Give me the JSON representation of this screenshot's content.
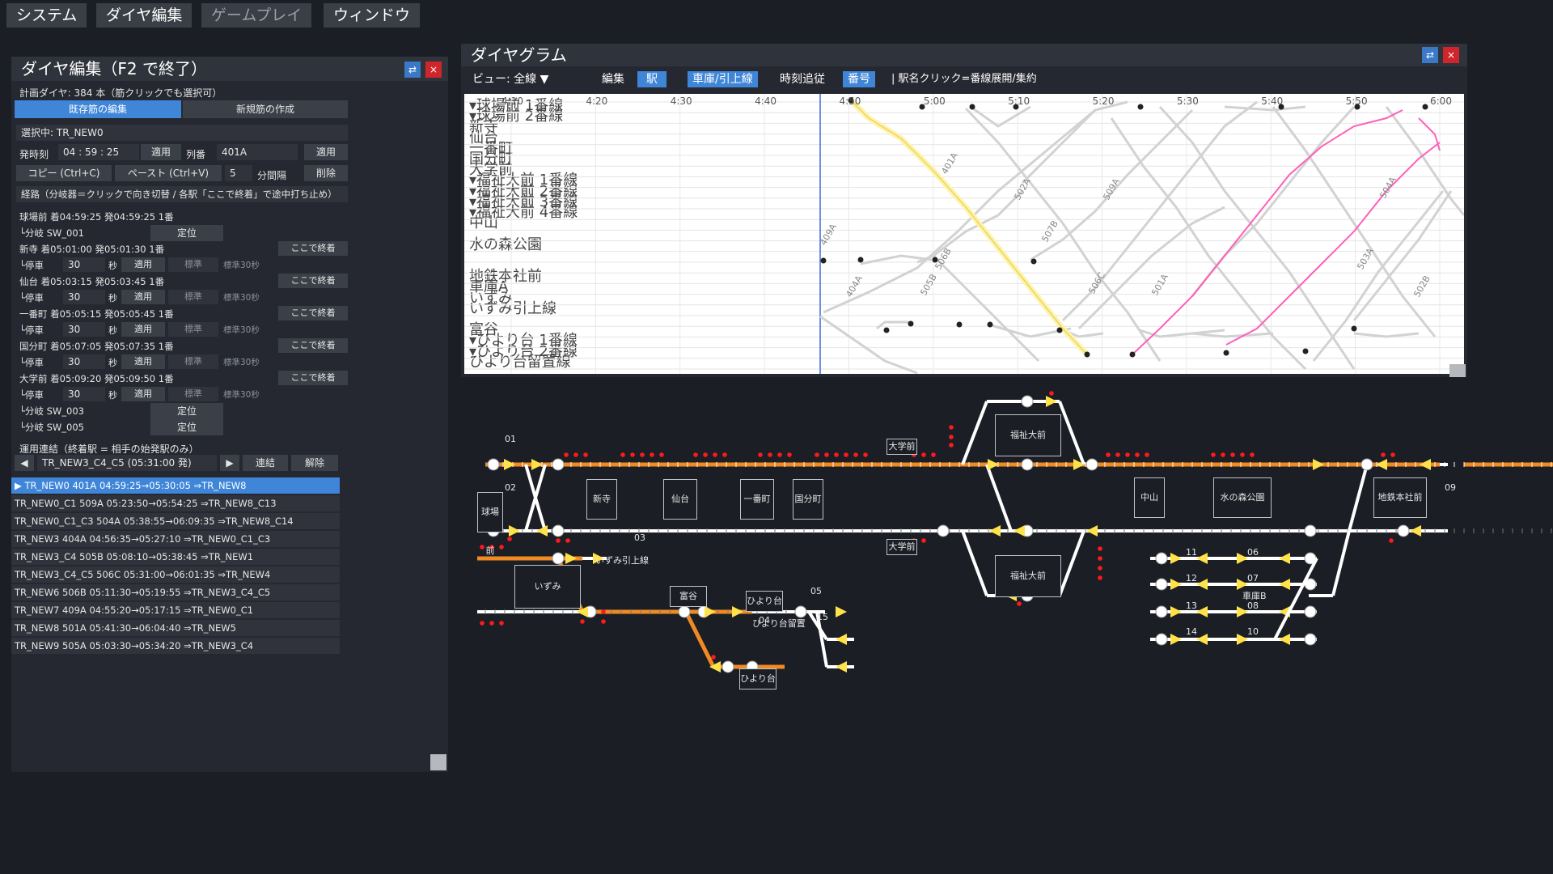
{
  "menu": [
    "システム",
    "ダイヤ編集",
    "ゲームプレイ",
    "ウィンドウ"
  ],
  "editor": {
    "title": "ダイヤ編集（F2 で終了）",
    "btn_restore": "⇄",
    "btn_close": "×",
    "plan_count": "計画ダイヤ: 384 本（筋クリックでも選択可）",
    "tab_existing": "既存筋の編集",
    "tab_new": "新規筋の作成",
    "selected": "選択中: TR_NEW0",
    "depart_label": "発時刻",
    "depart_h": "04",
    "depart_m": "59",
    "depart_s": "25",
    "apply": "適用",
    "trainno_label": "列番",
    "trainno": "401A",
    "copy": "コピー (Ctrl+C)",
    "paste": "ペースト (Ctrl+V)",
    "interval_value": "5",
    "interval_label": "分間隔",
    "delete": "削除",
    "route_header": "経路（分岐器＝クリックで向き切替 / 各駅「ここで終着」で途中打ち止め）",
    "route": [
      {
        "label": "球場前 着04:59:25 発04:59:25 1番"
      },
      {
        "label": "└分岐 SW_001",
        "switch": "定位"
      },
      {
        "label": "新寺 着05:01:00 発05:01:30 1番",
        "terminate": "ここで終着"
      },
      {
        "label": "└停車",
        "dwell": "30",
        "unit": "秒",
        "apply": "適用",
        "std": "標準",
        "std30": "標準30秒"
      },
      {
        "label": "仙台 着05:03:15 発05:03:45 1番",
        "terminate": "ここで終着"
      },
      {
        "label": "└停車",
        "dwell": "30",
        "unit": "秒",
        "apply": "適用",
        "std": "標準",
        "std30": "標準30秒"
      },
      {
        "label": "一番町 着05:05:15 発05:05:45 1番",
        "terminate": "ここで終着"
      },
      {
        "label": "└停車",
        "dwell": "30",
        "unit": "秒",
        "apply": "適用",
        "std": "標準",
        "std30": "標準30秒"
      },
      {
        "label": "国分町 着05:07:05 発05:07:35 1番",
        "terminate": "ここで終着"
      },
      {
        "label": "└停車",
        "dwell": "30",
        "unit": "秒",
        "apply": "適用",
        "std": "標準",
        "std30": "標準30秒"
      },
      {
        "label": "大学前 着05:09:20 発05:09:50 1番",
        "terminate": "ここで終着"
      },
      {
        "label": "└停車",
        "dwell": "30",
        "unit": "秒",
        "apply": "適用",
        "std": "標準",
        "std30": "標準30秒"
      },
      {
        "label": "└分岐 SW_003",
        "switch": "定位"
      },
      {
        "label": "└分岐 SW_005",
        "switch": "定位"
      }
    ],
    "link_header": "運用連結（終着駅 = 相手の始発駅のみ）",
    "link_prev": "◀",
    "link_next": "▶",
    "link_value": "TR_NEW3_C4_C5 (05:31:00 発)",
    "link_connect": "連結",
    "link_release": "解除",
    "trains": [
      "▶ TR_NEW0  401A  04:59:25→05:30:05 ⇒TR_NEW8",
      "TR_NEW0_C1  509A  05:23:50→05:54:25 ⇒TR_NEW8_C13",
      "TR_NEW0_C1_C3  504A  05:38:55→06:09:35 ⇒TR_NEW8_C14",
      "TR_NEW3  404A  04:56:35→05:27:10 ⇒TR_NEW0_C1_C3",
      "TR_NEW3_C4  505B  05:08:10→05:38:45 ⇒TR_NEW1",
      "TR_NEW3_C4_C5  506C  05:31:00→06:01:35 ⇒TR_NEW4",
      "TR_NEW6  506B  05:11:30→05:19:55 ⇒TR_NEW3_C4_C5",
      "TR_NEW7  409A  04:55:20→05:17:15 ⇒TR_NEW0_C1",
      "TR_NEW8  501A  05:41:30→06:04:40 ⇒TR_NEW5",
      "TR_NEW9  505A  05:03:30→05:34:20 ⇒TR_NEW3_C4"
    ]
  },
  "diagram": {
    "title": "ダイヤグラム",
    "btn_restore": "⇄",
    "btn_close": "×",
    "view": "ビュー: 全線 ▼",
    "edit": "編集",
    "mode_station": "駅",
    "mode_depot": "車庫/引上線",
    "follow": "時刻追従",
    "number": "番号",
    "hint": "| 駅名クリック=番線展開/集約",
    "times": [
      "4:10",
      "4:20",
      "4:30",
      "4:40",
      "4:50",
      "5:00",
      "5:10",
      "5:20",
      "5:30",
      "5:40",
      "5:50",
      "6:00"
    ],
    "stations": [
      {
        "name": "▾球場前 1番線",
        "row": 0
      },
      {
        "name": "▾球場前 2番線",
        "row": 1
      },
      {
        "name": "新寺",
        "row": 2
      },
      {
        "name": "仙台",
        "row": 3
      },
      {
        "name": "一番町",
        "row": 4
      },
      {
        "name": "国分町",
        "row": 5
      },
      {
        "name": "大学前",
        "row": 6
      },
      {
        "name": "▾福祉大前 1番線",
        "row": 7
      },
      {
        "name": "▾福祉大前 2番線",
        "row": 8
      },
      {
        "name": "▾福祉大前 3番線",
        "row": 9
      },
      {
        "name": "▾福祉大前 4番線",
        "row": 10
      },
      {
        "name": "中山",
        "row": 11
      },
      {
        "name": "水の森公園",
        "row": 13
      },
      {
        "name": "地鉄本社前",
        "row": 16
      },
      {
        "name": "車庫A",
        "row": 17
      },
      {
        "name": "いずみ",
        "row": 18
      },
      {
        "name": "いずみ引上線",
        "row": 19
      },
      {
        "name": "富谷",
        "row": 21
      },
      {
        "name": "▾ひより台 1番線",
        "row": 22
      },
      {
        "name": "▾ひより台 2番線",
        "row": 23
      },
      {
        "name": "ひより台留置線",
        "row": 24
      }
    ],
    "train_labels": [
      "401A",
      "502A",
      "509A",
      "504A",
      "409A",
      "507B",
      "506B",
      "505B",
      "404A",
      "506C",
      "501A",
      "503A",
      "502B"
    ],
    "colors": {
      "highlight": "#fff3a8",
      "selected": "#ff5fb8",
      "line": "#d2d2d2",
      "now": "#3a6ed8"
    }
  },
  "trackmap": {
    "stations_main": [
      "球場前",
      "新寺",
      "仙台",
      "一番町",
      "国分町",
      "大学前",
      "福祉大前",
      "大学前",
      "福祉大前",
      "中山",
      "水の森公園",
      "地鉄本社前"
    ],
    "platform_nums": [
      "01",
      "02",
      "09"
    ],
    "branch_labels": [
      "いずみ引上線",
      "いずみ",
      "富谷",
      "ひより台04",
      "ひより台留置",
      "ひより台",
      "03",
      "05",
      "15"
    ],
    "depot_nums": [
      "11",
      "06",
      "12",
      "07",
      "13",
      "08",
      "14",
      "10"
    ],
    "depot_tag": "車庫B",
    "colors": {
      "active": "#f08a24",
      "track": "#ffffff",
      "signal": "#ff1a1a",
      "arrow": "#ffe24a"
    }
  }
}
